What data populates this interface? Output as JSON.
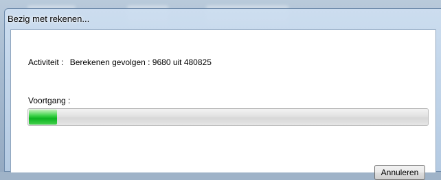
{
  "dialog": {
    "title": "Bezig met rekenen..."
  },
  "activity": {
    "label": "Activiteit :",
    "value": "Berekenen gevolgen : 9680 uit 480825"
  },
  "progress": {
    "label": "Voortgang :",
    "fraction": 0.07
  },
  "buttons": {
    "cancel_label": "Annuleren"
  },
  "colors": {
    "progress_fill": "#0db420",
    "window_frame": "#b6cce4"
  }
}
